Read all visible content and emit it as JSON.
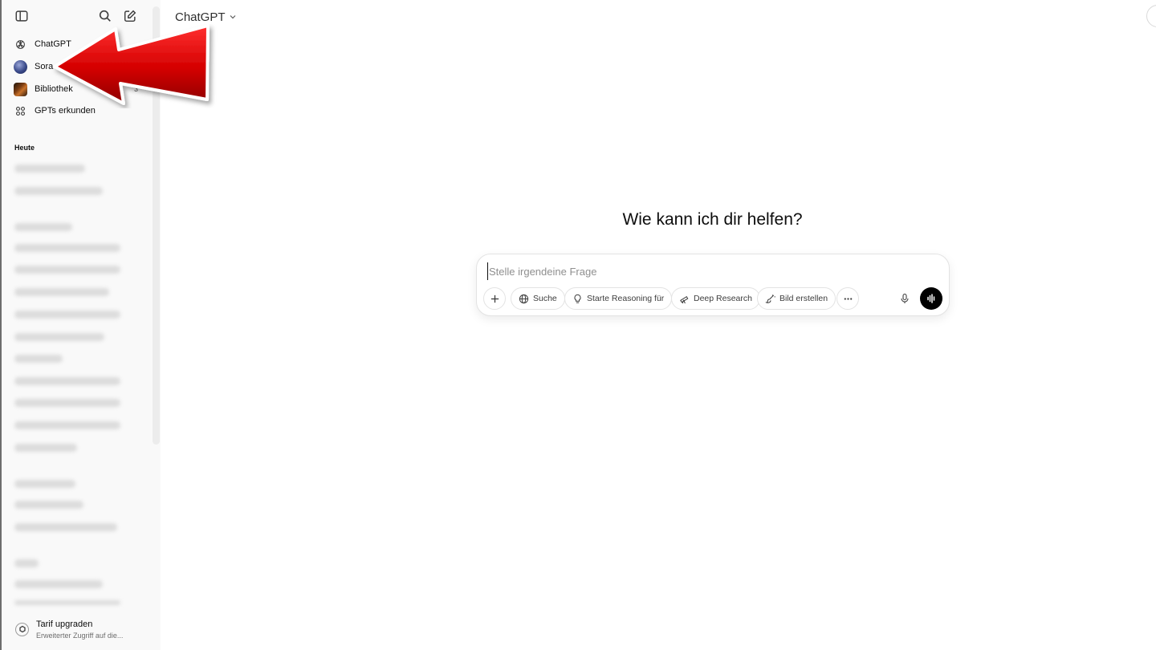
{
  "app": {
    "model_label": "ChatGPT"
  },
  "sidebar": {
    "items": [
      {
        "label": "ChatGPT",
        "icon": "openai-logo-icon"
      },
      {
        "label": "Sora",
        "icon": "sora-avatar"
      },
      {
        "label": "Bibliothek",
        "icon": "library-thumbnail",
        "badge": "3"
      },
      {
        "label": "GPTs erkunden",
        "icon": "grid-icon"
      }
    ],
    "section_today": "Heute",
    "upgrade": {
      "title": "Tarif upgraden",
      "subtitle": "Erweiterter Zugriff auf die..."
    }
  },
  "main": {
    "heading": "Wie kann ich dir helfen?",
    "composer": {
      "placeholder": "Stelle irgendeine Frage",
      "tools": [
        {
          "label": "Suche",
          "icon": "globe-icon"
        },
        {
          "label": "Starte Reasoning für",
          "icon": "lightbulb-icon"
        },
        {
          "label": "Deep Research",
          "icon": "telescope-icon"
        },
        {
          "label": "Bild erstellen",
          "icon": "image-brush-icon"
        }
      ]
    }
  },
  "colors": {
    "sidebar_bg": "#f9f9f9",
    "annotation_arrow": "#d40000",
    "voice_button": "#000000"
  }
}
